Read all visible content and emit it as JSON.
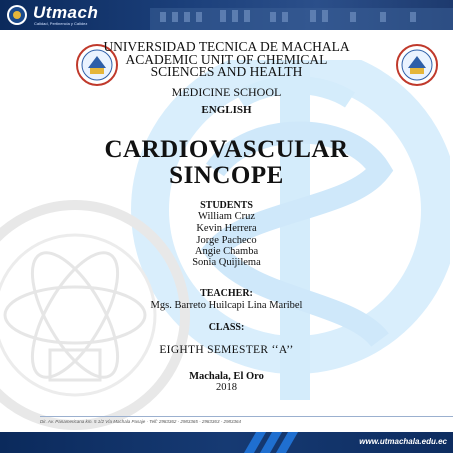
{
  "header": {
    "brand": "Utmach",
    "brand_subtitle": "Calidad, Pertinencia y Calidez"
  },
  "university": {
    "line1": "UNIVERSIDAD  TECNICA DE MACHALA",
    "line2": "ACADEMIC UNIT OF CHEMICAL",
    "line3": "SCIENCES AND HEALTH"
  },
  "school": "MEDICINE SCHOOL",
  "subject": "ENGLISH",
  "title": {
    "line1": "CARDIOVASCULAR",
    "line2": "SINCOPE"
  },
  "students": {
    "label": "STUDENTS",
    "names": [
      "William Cruz",
      "Kevin Herrera",
      "Jorge Pacheco",
      "Angie Chamba",
      "Sonia Quijilema"
    ]
  },
  "teacher": {
    "label": "TEACHER:",
    "name": "Mgs. Barreto Huilcapi Lina Maribel"
  },
  "class": {
    "label": "CLASS:",
    "value": "EIGHTH SEMESTER ‘‘A’’"
  },
  "location": "Machala, El Oro",
  "year": "2018",
  "footer": {
    "address": "Dir. Av. Panamericana km. 5 1/2 Vía Machala Pasaje · Telf: 2983362 - 2983365 - 2983363 - 2983364",
    "website": "www.utmachala.edu.ec"
  },
  "colors": {
    "banner": "#0b2a5c",
    "watermark_blue": "#d6ecfb",
    "watermark_gray": "#e6e6e6"
  },
  "icons": {
    "university_crest": "crest-icon",
    "caduceus_watermark": "caduceus-icon",
    "seal_watermark": "seal-icon"
  }
}
